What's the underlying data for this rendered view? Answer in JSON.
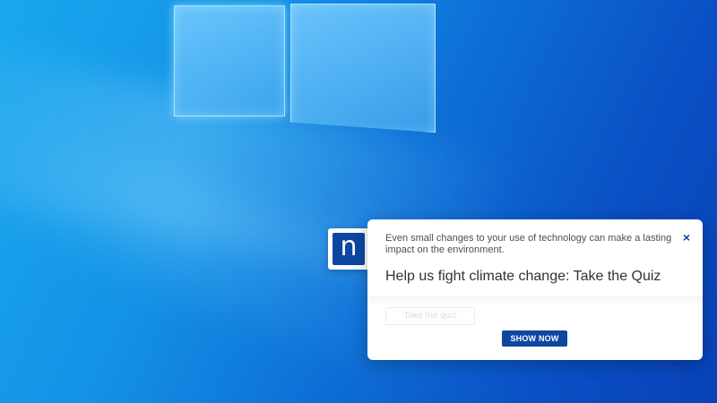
{
  "desktop": {
    "wallpaper": "windows-10-hero"
  },
  "app_badge": {
    "letter": "n",
    "icon": "app-logo-icon",
    "color": "#0d47a1"
  },
  "toast": {
    "body": "Even small changes to your use of technology can make a lasting impact on the environment.",
    "title": "Help us fight climate change: Take the Quiz",
    "close_symbol": "×",
    "faded_button_label": "Take the quiz",
    "primary_button_label": "SHOW NOW",
    "accent": "#0d47a1"
  }
}
